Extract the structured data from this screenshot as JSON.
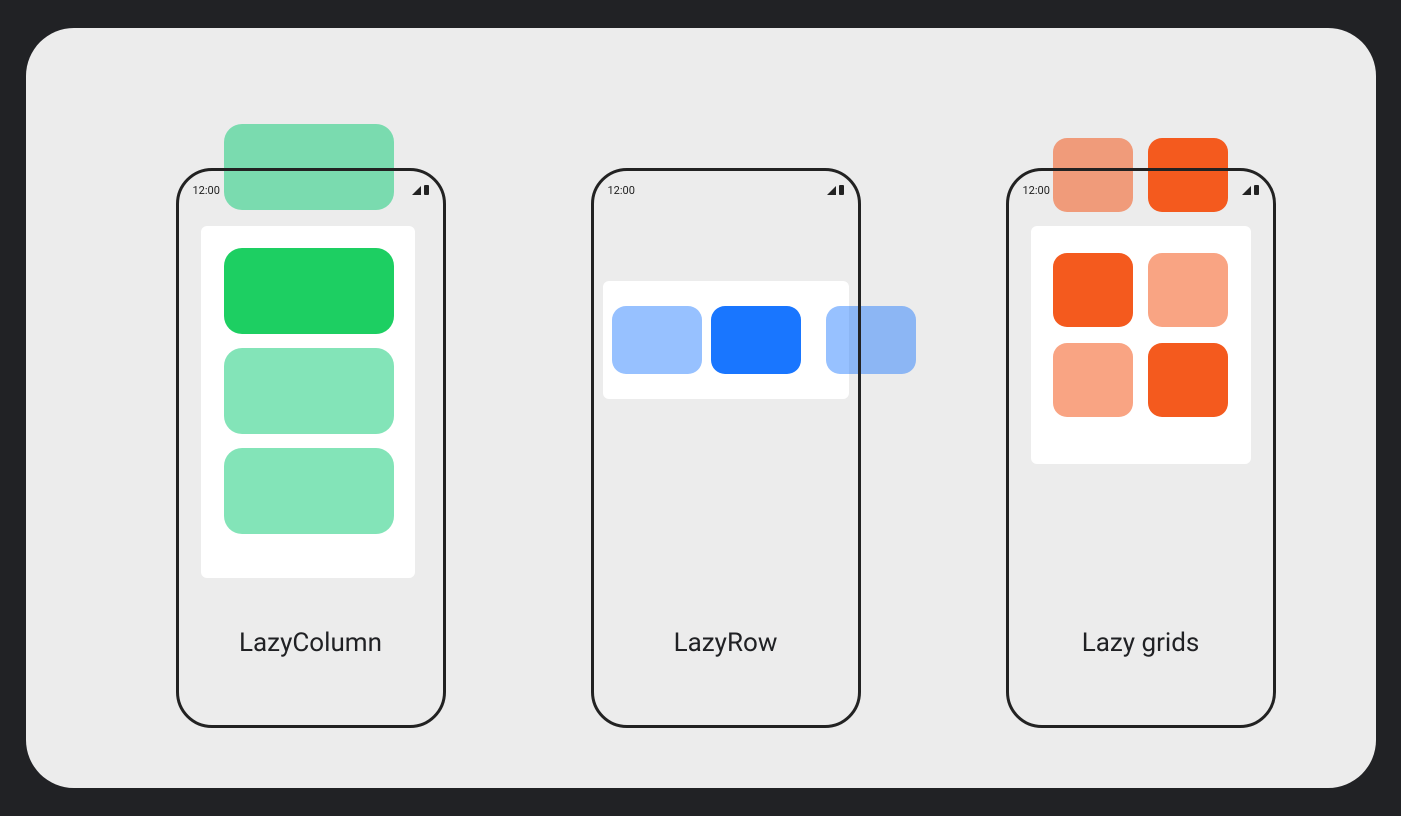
{
  "status_time": "12:00",
  "examples": [
    {
      "label": "LazyColumn"
    },
    {
      "label": "LazyRow"
    },
    {
      "label": "Lazy grids"
    }
  ],
  "colors": {
    "green_primary": "#1dcf62",
    "green_faded": "#1ecd7d",
    "blue_primary": "#1976ff",
    "orange_primary": "#f45a1e",
    "canvas_bg": "#ececec",
    "page_bg": "#212225"
  }
}
